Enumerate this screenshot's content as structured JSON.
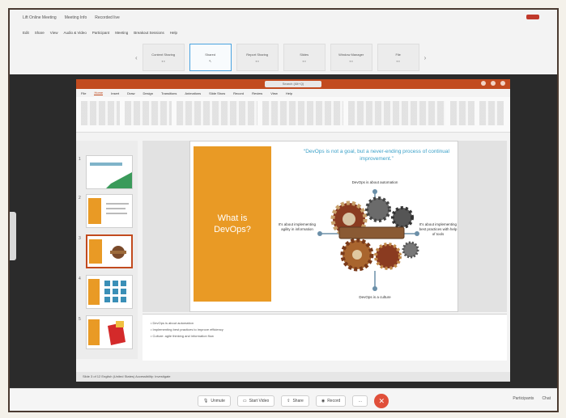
{
  "meeting": {
    "title_items": [
      "Lift Online Meeting",
      "Meeting Info",
      "Recorded live"
    ],
    "menu": [
      "Edit",
      "Share",
      "View",
      "Audio & Video",
      "Participant",
      "Meeting",
      "Breakout Sessions",
      "Help"
    ],
    "tabs": [
      {
        "label": "Content Sharing"
      },
      {
        "label": "Shared"
      },
      {
        "label": "Report Sharing"
      },
      {
        "label": "Slides"
      },
      {
        "label": "Window Manager"
      },
      {
        "label": "File"
      }
    ]
  },
  "ppt": {
    "search_text": "Search (Alt+Q)",
    "ribbon_tabs": [
      "File",
      "Home",
      "Insert",
      "Draw",
      "Design",
      "Transitions",
      "Animations",
      "Slide Show",
      "Record",
      "Review",
      "View",
      "Help"
    ],
    "active_tab": "Home",
    "slide": {
      "left_title": "What is DevOps?",
      "quote": "“DevOps is not a goal, but a never-ending process of continual improvement.”",
      "label_top": "DevOps is about automation",
      "label_left": "It's about implementing agility in information",
      "label_right": "It's about implementing best practices with help of tools",
      "label_bottom": "DevOps is a culture"
    },
    "thumb_numbers": [
      "1",
      "2",
      "3",
      "4",
      "5"
    ],
    "notes": [
      "• DevOps is about automation",
      "• Implementing best practices to improve efficiency",
      "• Culture: agile thinking and information flow"
    ],
    "status": "Slide 3 of 12   English (United States)   Accessibility: Investigate"
  },
  "toolbar": {
    "buttons": [
      "Unmute",
      "Start Video",
      "Share",
      "Record",
      "…"
    ],
    "right": [
      "Participants",
      "Chat"
    ],
    "leave_icon": "x-icon"
  },
  "colors": {
    "accent": "#c24b1f",
    "slide_orange": "#e99a25",
    "quote_blue": "#3aa0c8",
    "leave_red": "#e04f3a"
  }
}
